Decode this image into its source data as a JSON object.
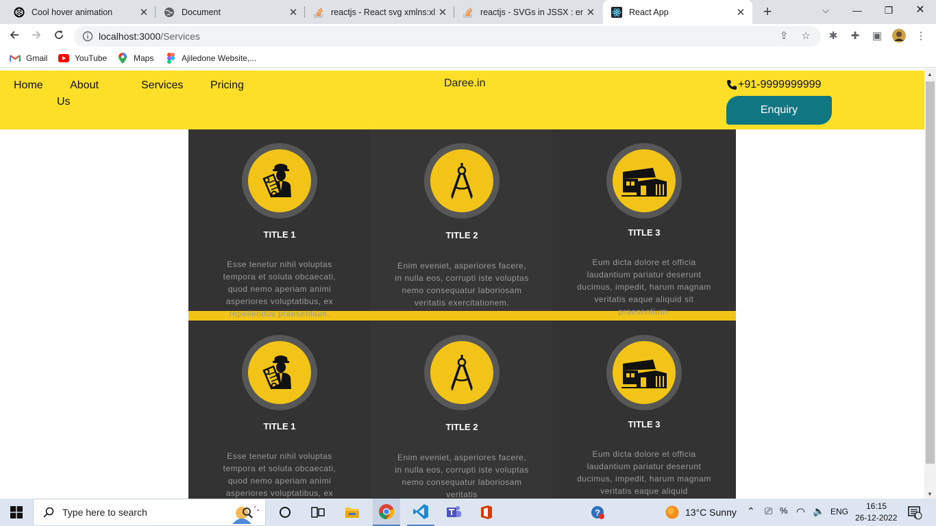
{
  "browser": {
    "tabs": [
      {
        "title": "Cool hover animation",
        "active": false
      },
      {
        "title": "Document",
        "active": false
      },
      {
        "title": "reactjs - React svg xmlns:xlink",
        "active": false
      },
      {
        "title": "reactjs - SVGs in JSSX : enabl",
        "active": false
      },
      {
        "title": "React App",
        "active": true
      }
    ],
    "url_host": "localhost:3000",
    "url_path": "/Services",
    "bookmarks": [
      {
        "label": "Gmail",
        "icon": "gmail-icon"
      },
      {
        "label": "YouTube",
        "icon": "youtube-icon"
      },
      {
        "label": "Maps",
        "icon": "maps-icon"
      },
      {
        "label": "Ajiledone Website,...",
        "icon": "figma-icon"
      }
    ]
  },
  "site": {
    "nav": {
      "home": "Home",
      "about_line1": "About",
      "about_line2": "Us",
      "services": "Services",
      "pricing": "Pricing"
    },
    "brand": "Daree.in",
    "phone": "+91-9999999999",
    "enquiry_label": "Enquiry",
    "colors": {
      "header": "#fcdf26",
      "enquiry": "#0f7682",
      "panel": "#333333",
      "accent": "#f1c417"
    }
  },
  "services": [
    {
      "title": "TITLE 1",
      "icon": "engineer-icon",
      "text": "Esse tenetur nihil voluptas tempora et soluta obcaecati, quod nemo aperiam animi asperiores voluptatibus, ex repellendus praesentium."
    },
    {
      "title": "TITLE 2",
      "icon": "compass-icon",
      "text": "Enim eveniet, asperiores facere, in nulla eos, corrupti iste voluptas nemo consequatur laboriosam veritatis exercitationem."
    },
    {
      "title": "TITLE 3",
      "icon": "building-icon",
      "text": "Eum dicta dolore et officia laudantium pariatur deserunt ducimus, impedit, harum magnam veritatis eaque aliquid sit praesentium."
    },
    {
      "title": "TITLE 1",
      "icon": "engineer-icon",
      "text": "Esse tenetur nihil voluptas tempora et soluta obcaecati, quod nemo aperiam animi asperiores voluptatibus, ex"
    },
    {
      "title": "TITLE 2",
      "icon": "compass-icon",
      "text": "Enim eveniet, asperiores facere, in nulla eos, corrupti iste voluptas nemo consequatur laboriosam veritatis"
    },
    {
      "title": "TITLE 3",
      "icon": "building-icon",
      "text": "Eum dicta dolore et officia laudantium pariatur deserunt ducimus, impedit, harum magnam veritatis eaque aliquid"
    }
  ],
  "taskbar": {
    "search_placeholder": "Type here to search",
    "weather": "13°C  Sunny",
    "language": "ENG",
    "time": "16:15",
    "date": "26-12-2022",
    "notification_count": "1"
  }
}
